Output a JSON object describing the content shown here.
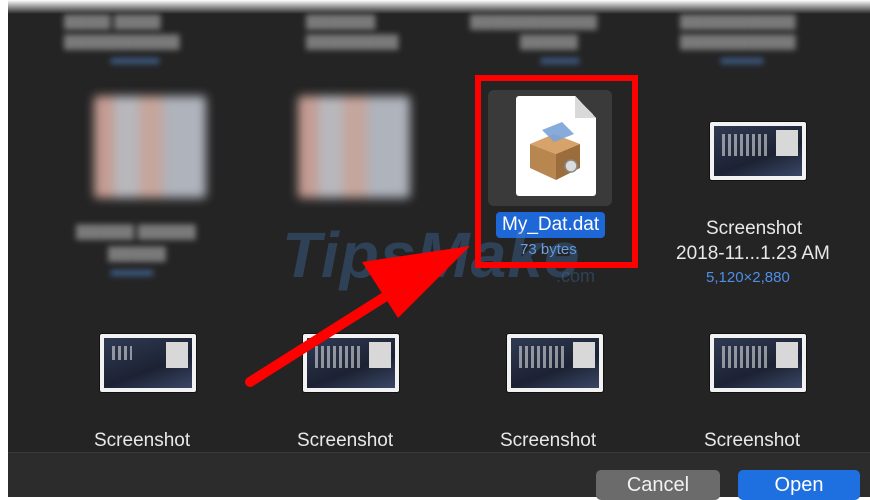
{
  "file_browser": {
    "selected_file": {
      "name": "My_Dat.dat",
      "size": "73 bytes",
      "icon": "dat-file-icon"
    },
    "items": [
      {
        "title": "Screenshot",
        "subtitle": "2018-11...1.23 AM",
        "dimensions": "5,120×2,880"
      },
      {
        "title": "Screenshot"
      },
      {
        "title": "Screenshot"
      },
      {
        "title": "Screenshot"
      },
      {
        "title": "Screenshot"
      }
    ]
  },
  "watermark": {
    "brand": "TipsMake",
    "suffix": ".com"
  },
  "footer": {
    "cancel_label": "Cancel",
    "open_label": "Open"
  },
  "colors": {
    "highlight": "#ff0000",
    "selection": "#1e67d6",
    "primary_button": "#1e6fe0"
  }
}
